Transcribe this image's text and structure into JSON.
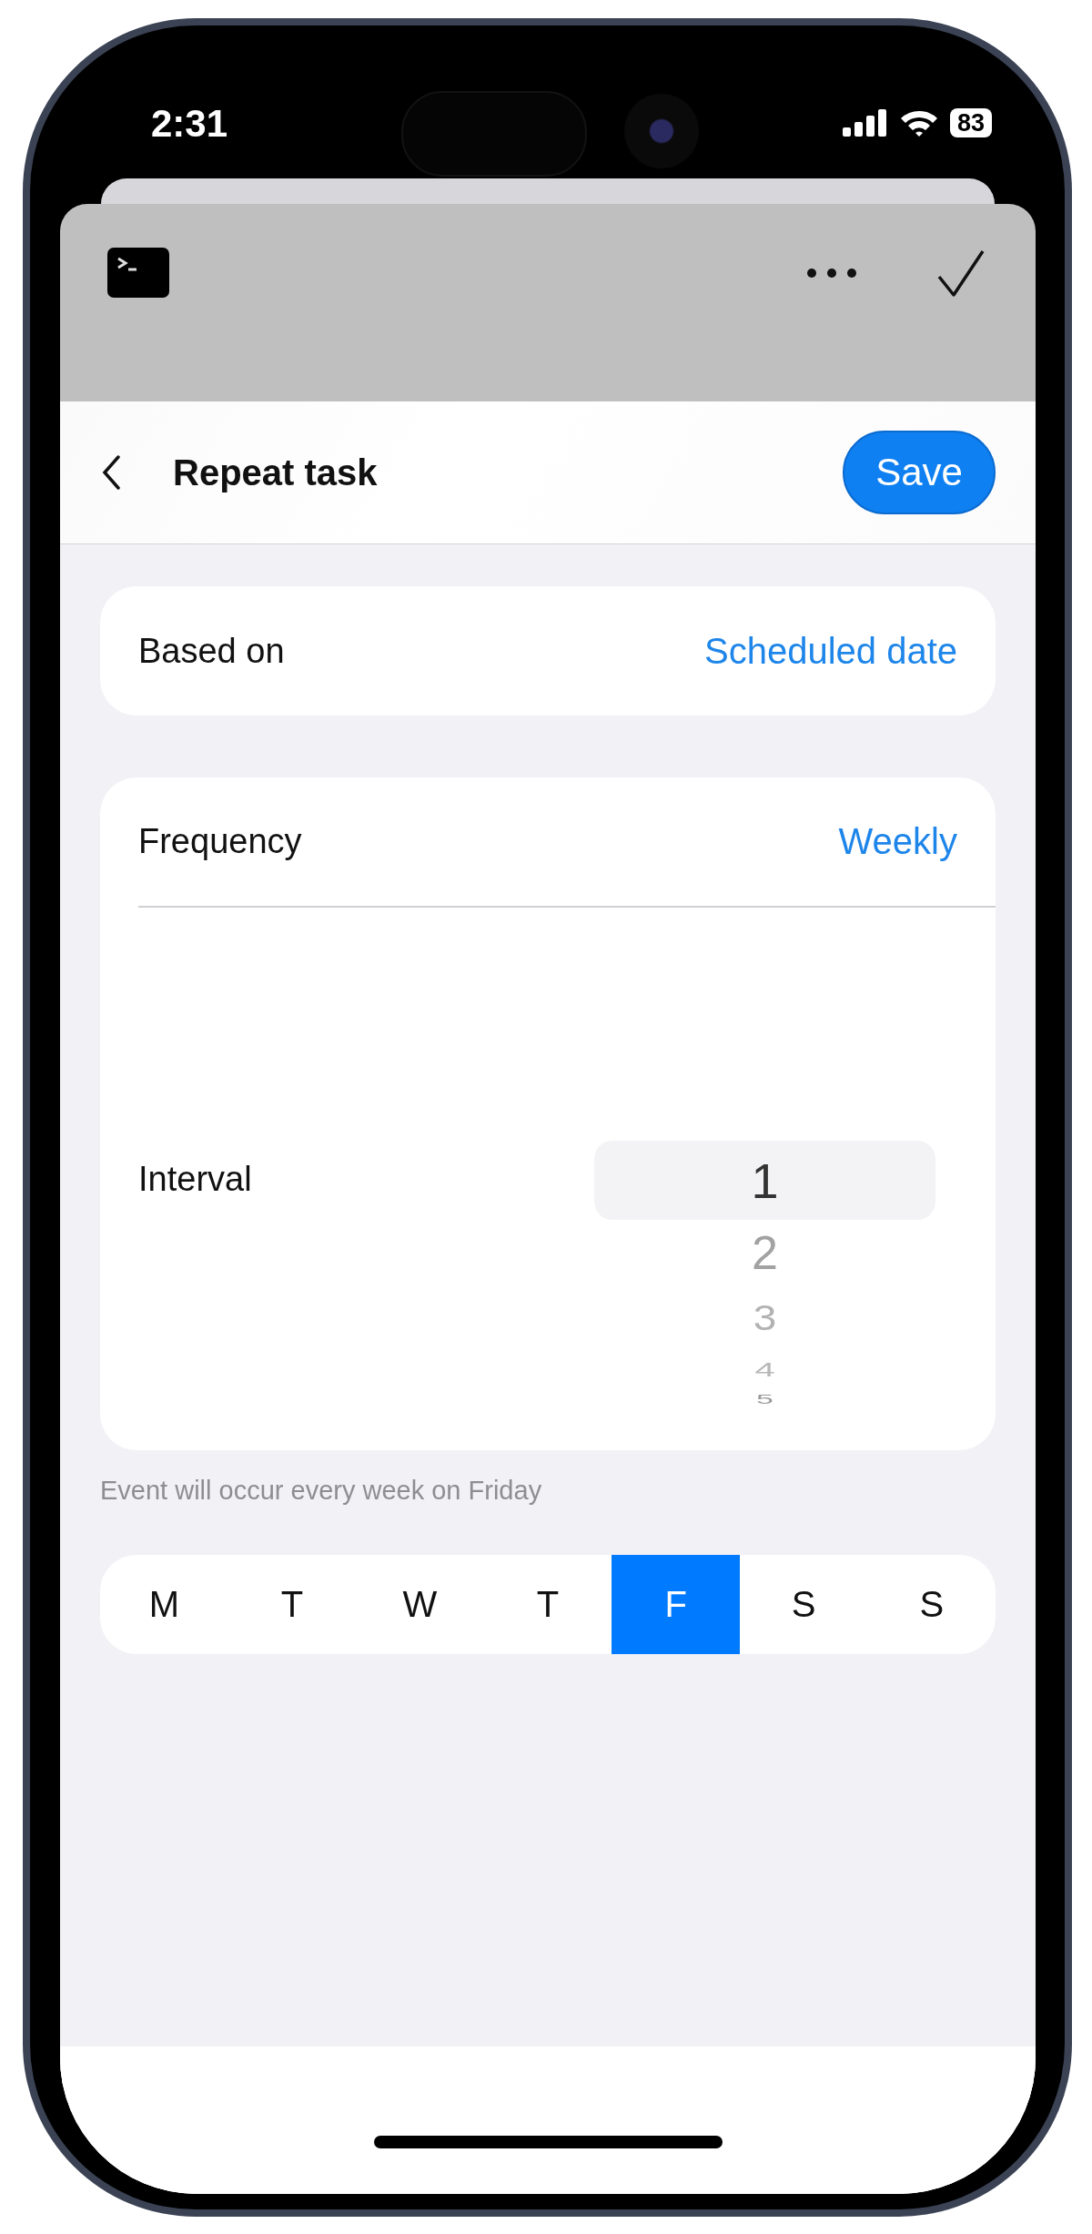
{
  "status_bar": {
    "time": "2:31",
    "battery": "83"
  },
  "header": {
    "title": "Repeat task",
    "save_button": "Save"
  },
  "based_on": {
    "label": "Based on",
    "value": "Scheduled date"
  },
  "frequency": {
    "label": "Frequency",
    "value": "Weekly"
  },
  "interval": {
    "label": "Interval",
    "options": [
      {
        "label": "1",
        "selected": true
      },
      {
        "label": "2",
        "selected": false
      },
      {
        "label": "3",
        "selected": false
      },
      {
        "label": "4",
        "selected": false
      },
      {
        "label": "5",
        "selected": false
      }
    ]
  },
  "summary": "Event will occur every week on Friday",
  "days": [
    {
      "label": "M",
      "selected": false
    },
    {
      "label": "T",
      "selected": false
    },
    {
      "label": "W",
      "selected": false
    },
    {
      "label": "T",
      "selected": false
    },
    {
      "label": "F",
      "selected": true
    },
    {
      "label": "S",
      "selected": false
    },
    {
      "label": "S",
      "selected": false
    }
  ]
}
